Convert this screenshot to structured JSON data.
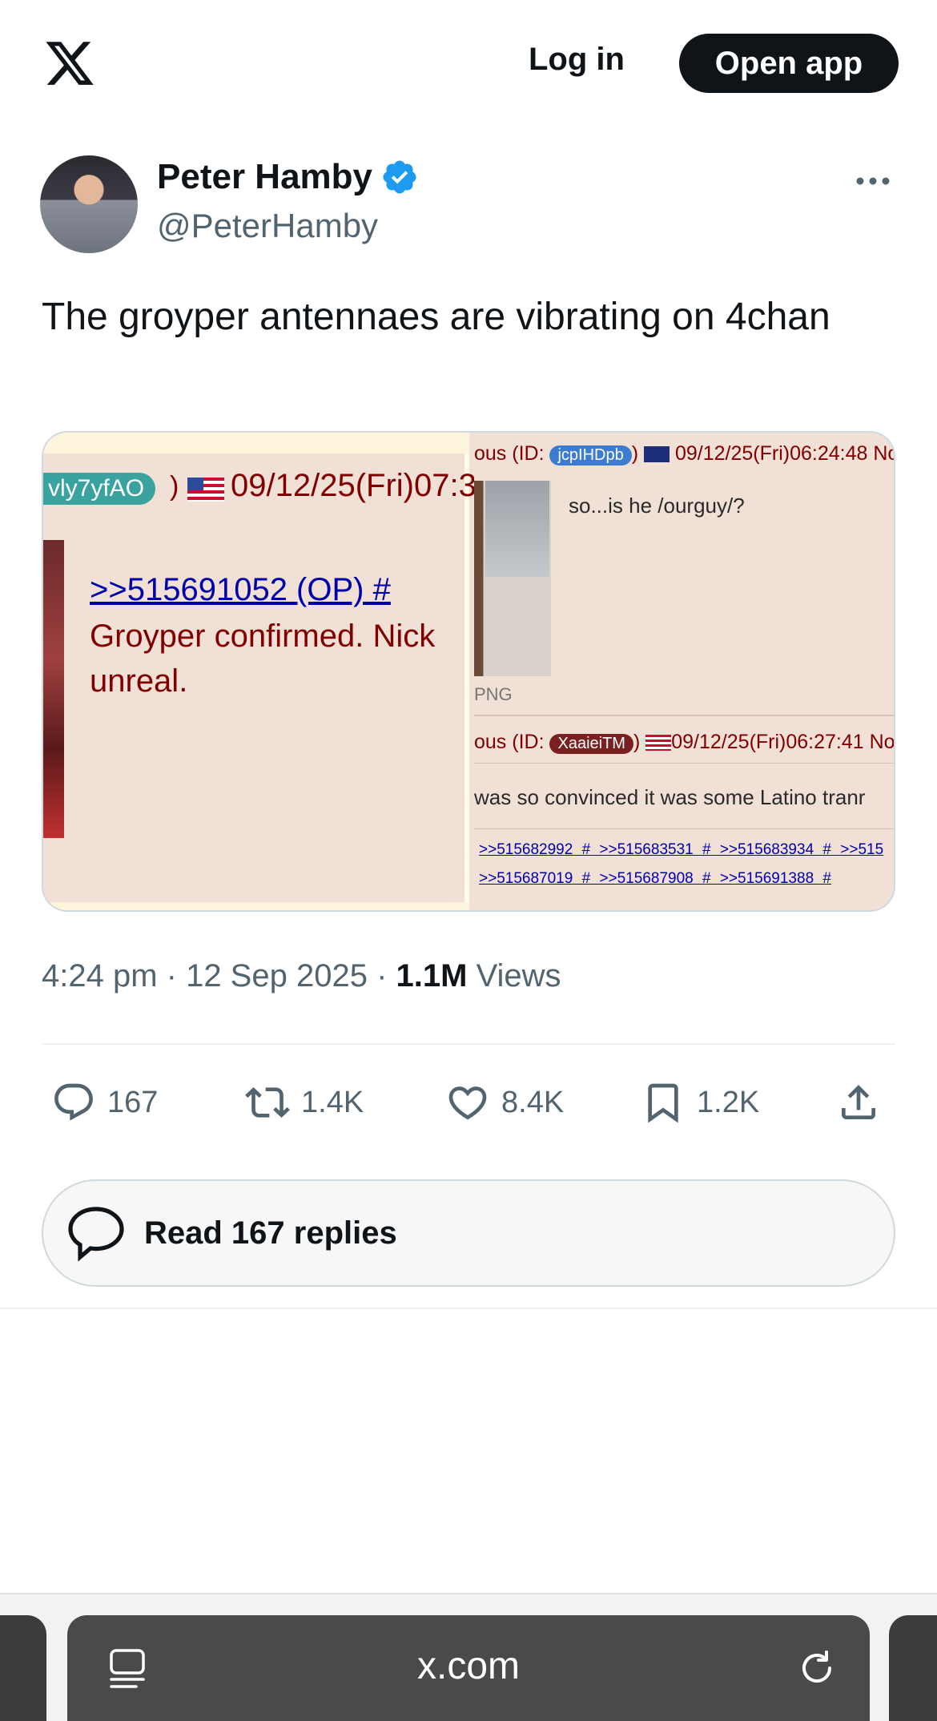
{
  "header": {
    "login_label": "Log in",
    "open_app_label": "Open app",
    "logo_icon": "x-logo-icon"
  },
  "author": {
    "name": "Peter Hamby",
    "handle": "@PeterHamby",
    "verified": true,
    "verified_color": "#1d9bf0"
  },
  "tweet": {
    "text": "The groyper antennaes are vibrating on 4chan"
  },
  "media": {
    "left": {
      "post_id": "vly7yfAO",
      "date": "09/12/25(Fri)07:3",
      "quote_link": ">>515691052 (OP) #",
      "body": "Groyper confirmed. Nick unreal."
    },
    "right": {
      "post1_head": "ous (ID: ",
      "post1_id": "jcpIHDpb",
      "post1_date": "09/12/25(Fri)06:24:48 No",
      "post1_text": "so...is he /ourguy/?",
      "post1_file": "PNG",
      "post2_head": "ous (ID: ",
      "post2_id": "XaaieiTM",
      "post2_date": "09/12/25(Fri)06:27:41 No",
      "post2_text": "was so convinced it was some Latino tranr",
      "links_row1": ">>515682992 # >>515683531 # >>515683934 # >>515",
      "links_row2": ">>515687019 # >>515687908 # >>515691388 #"
    }
  },
  "meta": {
    "time": "4:24 pm",
    "date": "12 Sep 2025",
    "views_count": "1.1M",
    "views_label": "Views"
  },
  "actions": {
    "replies": "167",
    "reposts": "1.4K",
    "likes": "8.4K",
    "bookmarks": "1.2K"
  },
  "read_replies_label": "Read 167 replies",
  "browser": {
    "url": "x.com"
  }
}
